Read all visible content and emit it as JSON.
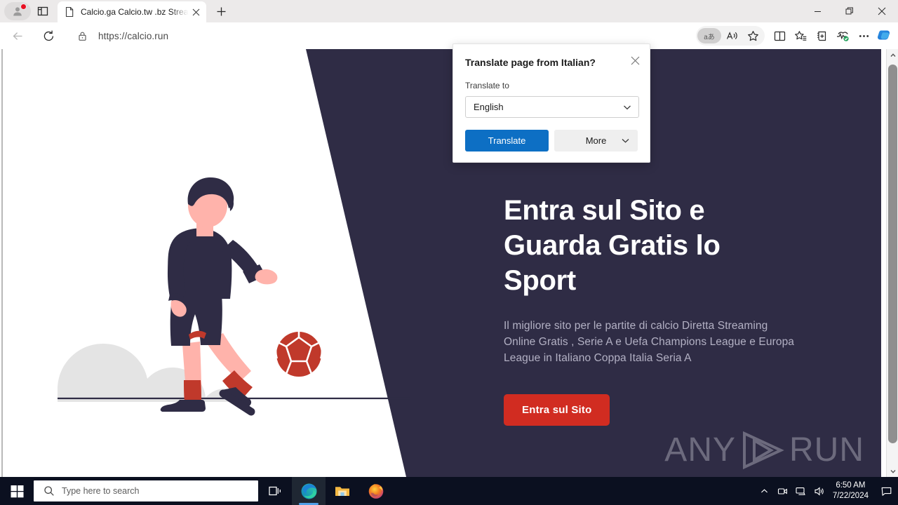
{
  "browser": {
    "tab": {
      "title": "Calcio.ga Calcio.tw .bz Streaming",
      "favicon_icon": "page-icon",
      "close_icon": "close-icon"
    },
    "new_tab_icon": "plus-icon",
    "tab_actions_icon": "tab-actions-icon",
    "profile_icon": "profile-avatar-icon",
    "window_controls": {
      "minimize_icon": "minimize-icon",
      "maximize_icon": "restore-icon",
      "close_icon": "close-icon"
    },
    "toolbar": {
      "back_icon": "back-arrow-icon",
      "reload_icon": "reload-icon",
      "lock_icon": "lock-icon",
      "url": "https://calcio.run",
      "translate_chip_label": "aあ",
      "read_aloud_icon": "read-aloud-icon",
      "favorite_icon": "star-icon",
      "split_screen_icon": "split-screen-icon",
      "favorites_list_icon": "favorites-icon",
      "collections_icon": "collections-icon",
      "browser_essentials_icon": "browser-essentials-icon",
      "settings_icon": "ellipsis-icon",
      "copilot_icon": "copilot-icon"
    },
    "scrollbar": {
      "up_icon": "chevron-up-icon",
      "down_icon": "chevron-down-icon"
    }
  },
  "translate_dialog": {
    "title": "Translate page from Italian?",
    "close_icon": "close-icon",
    "label": "Translate to",
    "selected_language": "English",
    "chevron_icon": "chevron-down-icon",
    "translate_label": "Translate",
    "more_label": "More"
  },
  "page": {
    "heading": "Entra sul Sito e Guarda Gratis lo Sport",
    "subheading": "Il migliore sito per le partite di calcio Diretta Streaming Online Gratis , Serie A e Uefa Champions League e Europa League in Italiano Coppa Italia Seria A",
    "cta_label": "Entra sul Sito",
    "watermark": {
      "left_text": "ANY",
      "right_text": "RUN",
      "play_icon": "play-triangle-icon"
    },
    "colors": {
      "panel_background": "#2f2c45",
      "cta_background": "#d12c21",
      "accent_red": "#c0392b",
      "skin": "#ffb3ab",
      "kit_dark": "#2f2c45",
      "cloud_gray": "#e4e4e4"
    },
    "illustration_name": "soccer-player-illustration"
  },
  "taskbar": {
    "start_icon": "windows-start-icon",
    "search_icon": "search-icon",
    "search_placeholder": "Type here to search",
    "task_view_icon": "task-view-icon",
    "apps": [
      {
        "name": "microsoft-edge",
        "icon": "edge-icon"
      },
      {
        "name": "file-explorer",
        "icon": "folder-icon"
      },
      {
        "name": "mozilla-firefox",
        "icon": "firefox-icon"
      }
    ],
    "tray": {
      "overflow_icon": "chevron-up-icon",
      "camera_icon": "camera-icon",
      "network_icon": "network-icon",
      "volume_icon": "volume-icon",
      "action_center_icon": "notification-icon"
    },
    "time": "6:50 AM",
    "date": "7/22/2024"
  }
}
